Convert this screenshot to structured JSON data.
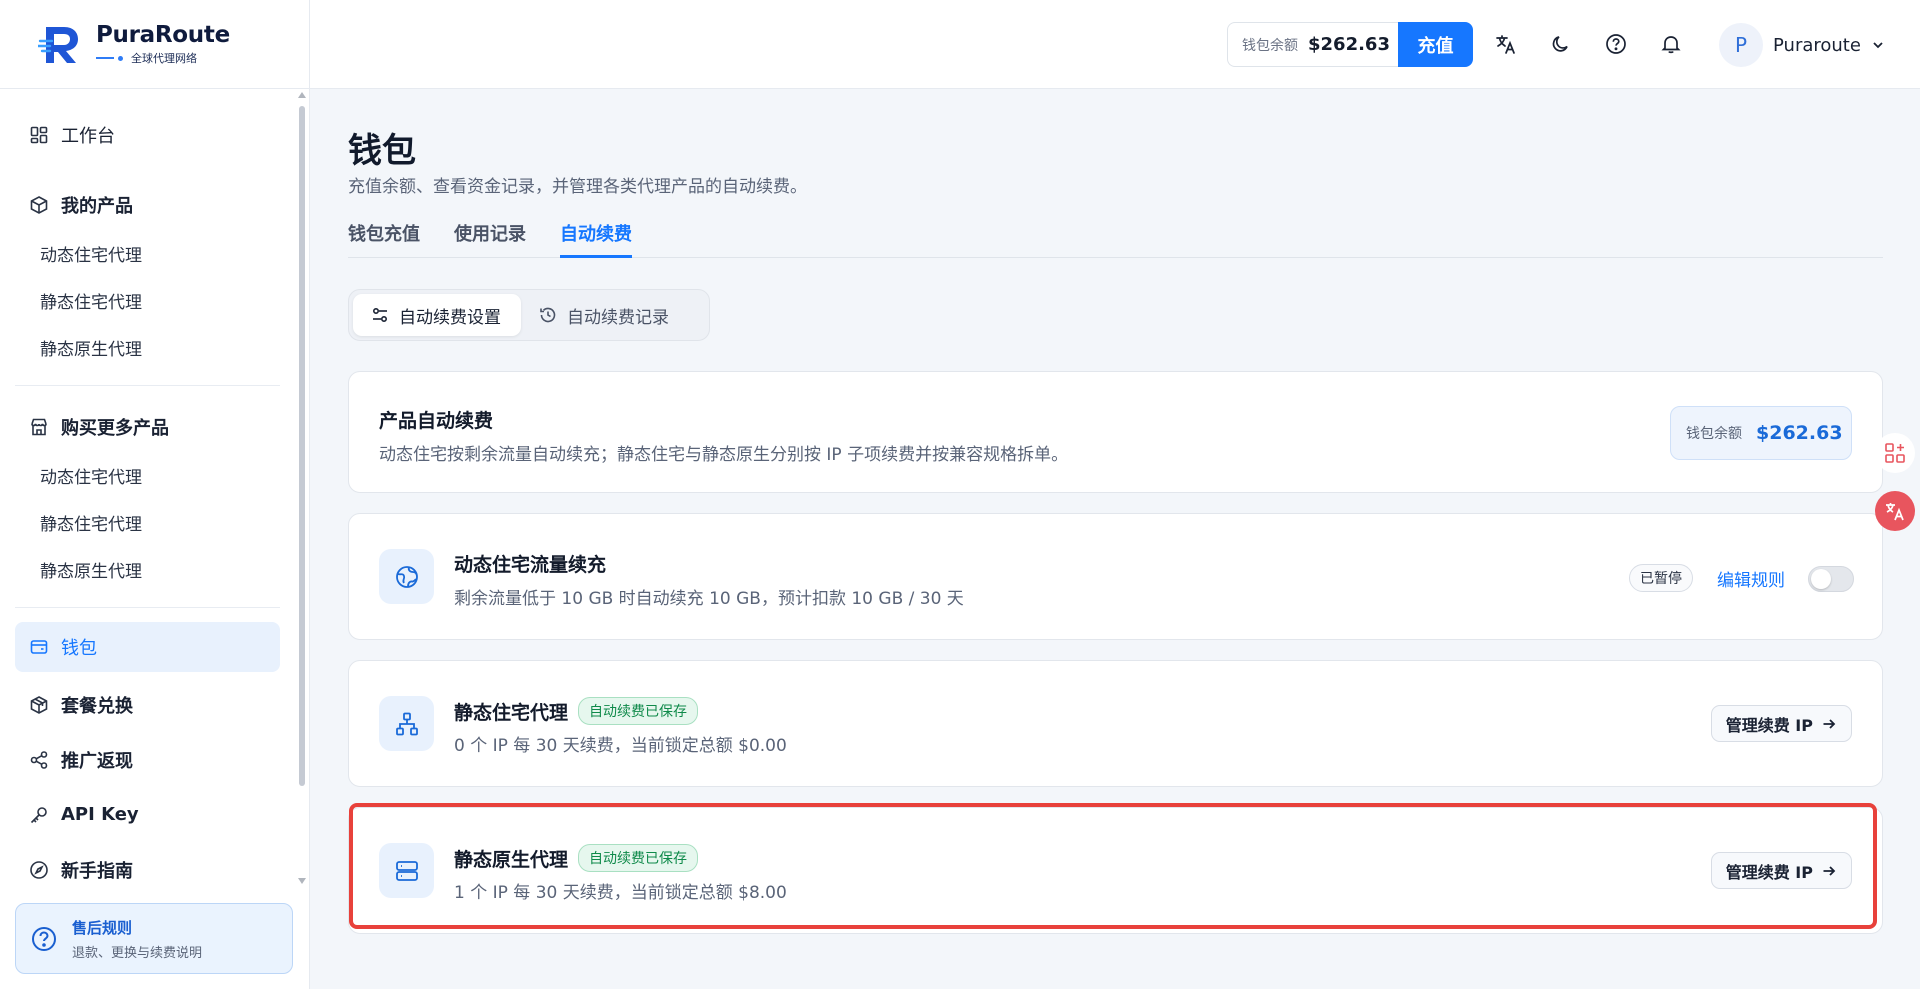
{
  "brand": {
    "name": "PuraRoute",
    "tagline": "全球代理网络"
  },
  "header": {
    "balance_label": "钱包余额",
    "balance_value": "$262.63",
    "recharge_label": "充值",
    "user_initial": "P",
    "user_name": "Puraroute"
  },
  "sidebar": {
    "workbench": "工作台",
    "my_products": {
      "label": "我的产品",
      "items": [
        "动态住宅代理",
        "静态住宅代理",
        "静态原生代理"
      ]
    },
    "buy_more": {
      "label": "购买更多产品",
      "items": [
        "动态住宅代理",
        "静态住宅代理",
        "静态原生代理"
      ]
    },
    "wallet": "钱包",
    "package_redeem": "套餐兑换",
    "referral": "推广返现",
    "api_key": "API Key",
    "guide": "新手指南",
    "help": {
      "title": "售后规则",
      "subtitle": "退款、更换与续费说明"
    }
  },
  "page": {
    "title": "钱包",
    "description": "充值余额、查看资金记录，并管理各类代理产品的自动续费。",
    "tabs": [
      "钱包充值",
      "使用记录",
      "自动续费"
    ],
    "active_tab": "自动续费",
    "segments": [
      "自动续费设置",
      "自动续费记录"
    ]
  },
  "summary": {
    "title": "产品自动续费",
    "description": "动态住宅按剩余流量自动续充；静态住宅与静态原生分别按 IP 子项续费并按兼容规格拆单。",
    "wallet_label": "钱包余额",
    "wallet_value": "$262.63"
  },
  "dynamic": {
    "title": "动态住宅流量续充",
    "description": "剩余流量低于 10 GB 时自动续充 10 GB，预计扣款 10 GB / 30 天",
    "status": "已暂停",
    "edit_label": "编辑规则",
    "enabled": false
  },
  "static_residential": {
    "title": "静态住宅代理",
    "badge": "自动续费已保存",
    "description": "0 个 IP 每 30 天续费，当前锁定总额 $0.00",
    "button": "管理续费 IP"
  },
  "static_native": {
    "title": "静态原生代理",
    "badge": "自动续费已保存",
    "description": "1 个 IP 每 30 天续费，当前锁定总额 $8.00",
    "button": "管理续费 IP"
  },
  "colors": {
    "accent": "#1677ff",
    "highlight": "#e8413b",
    "success": "#0f8a4a"
  }
}
